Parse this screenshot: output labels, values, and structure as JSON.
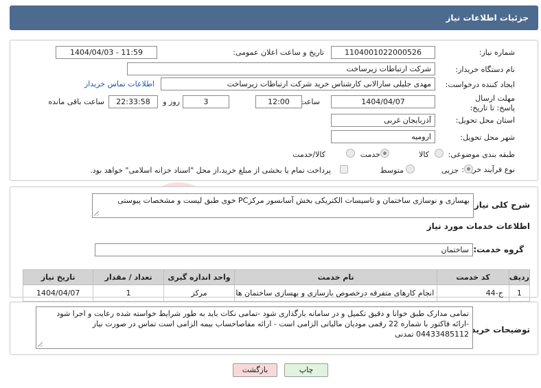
{
  "header": {
    "title": "جزئیات اطلاعات نیاز"
  },
  "fields": {
    "need_number_label": "شماره نیاز:",
    "need_number": "1104001022000526",
    "announce_label": "تاریخ و ساعت اعلان عمومی:",
    "announce_value": "1404/04/03 - 11:59",
    "buyer_org_label": "نام دستگاه خریدار:",
    "buyer_org": "شرکت ارتباطات زیرساخت",
    "creator_label": "ایجاد کننده درخواست:",
    "creator": "مهدی جلیلی سارالانی کارشناس خرید شرکت ارتباطات زیرساخت",
    "contact_link": "اطلاعات تماس خریدار",
    "deadline_label": "مهلت ارسال پاسخ: تا تاریخ:",
    "deadline_date": "1404/04/07",
    "time_label": "ساعت",
    "deadline_time": "12:00",
    "days_value": "3",
    "days_label": "روز و",
    "remaining_time": "22:33:58",
    "remaining_label": "ساعت باقی مانده",
    "province_label": "استان محل تحویل:",
    "province": "آذربایجان غربی",
    "city_label": "شهر محل تحویل:",
    "city": "ارومیه",
    "category_label": "طبقه بندی موضوعی:",
    "category_options": [
      "کالا",
      "خدمت",
      "کالا/خدمت"
    ],
    "category_selected": "خدمت",
    "process_label": "نوع فرآیند خرید :",
    "process_options": [
      "جزیی",
      "متوسط"
    ],
    "process_selected": "جزیی",
    "treasury_note": "پرداخت تمام یا بخشی از مبلغ خرید،از محل \"اسناد خزانه اسلامی\" خواهد بود."
  },
  "summary": {
    "label": "شرح کلی نیاز:",
    "text": "بهسازی و نوسازی ساختمان و تاسیسات الکتریکی بخش آسانسور مرکزPC خوی طبق لیست و مشخصات پیوستی"
  },
  "services": {
    "section_title": "اطلاعات خدمات مورد نیاز",
    "group_label": "گروه خدمت:",
    "group_value": "ساختمان",
    "columns": [
      "ردیف",
      "کد خدمت",
      "نام خدمت",
      "واحد اندازه گیری",
      "تعداد / مقدار",
      "تاریخ نیاز"
    ],
    "rows": [
      [
        "1",
        "ج-44",
        "انجام کارهای متفرقه درخصوص بازسازی و بهسازی ساختمان ها",
        "مرکز",
        "1",
        "1404/04/07"
      ]
    ]
  },
  "buyer_notes": {
    "label": "توضیحات خریدار:",
    "text": "تمامی مدارک طبق خوانا و دقیق تکمیل و در سامانه بارگذاری شود -تمامی نکات باید به طور شرایط خواسته شده رعایت و اجرا شود -ارائه فاکتور با شماره 22 رقمی مودیان مالیاتی الزامی است - ارائه مفاصاحساب بیمه الزامی است تماس در صورت نیاز 04433485112 تمدنی"
  },
  "buttons": {
    "print": "چاپ",
    "back": "بازگشت"
  },
  "watermark": {
    "text": "AriaTender.net"
  },
  "colors": {
    "header": "#4d6a8f",
    "link": "#1b53b8",
    "print_btn": "#dff3df",
    "back_btn": "#f6dada"
  }
}
